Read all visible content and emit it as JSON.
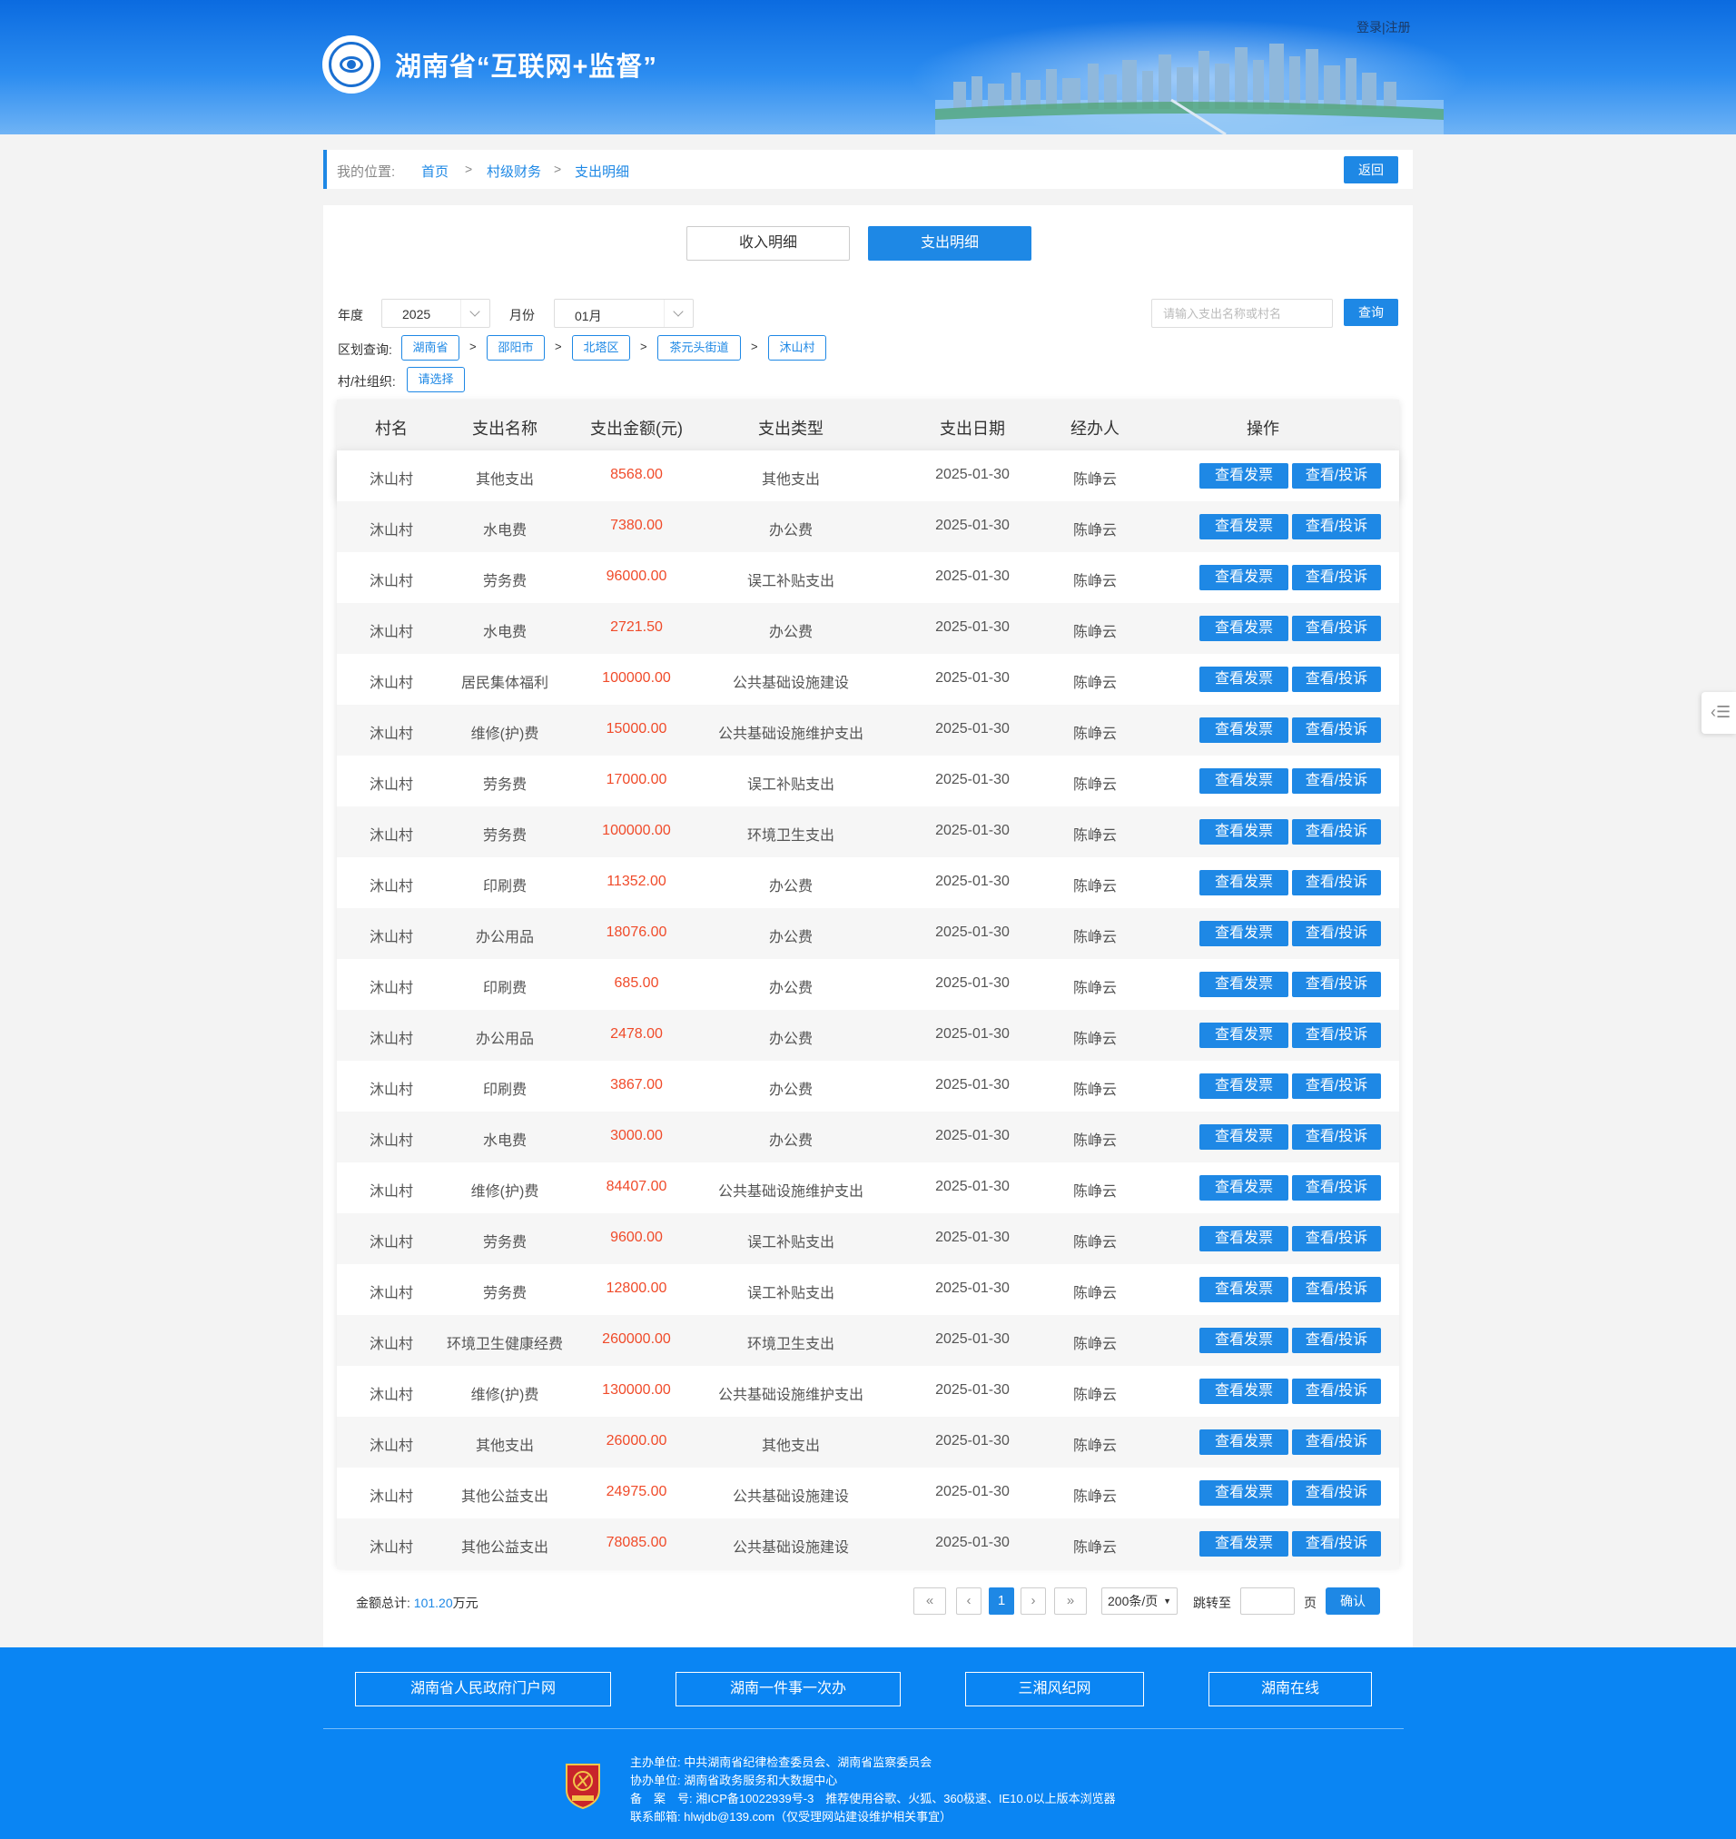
{
  "header": {
    "site_title": "湖南省“互联网+监督”",
    "login": "登录",
    "divider": "|",
    "register": "注册"
  },
  "breadcrumb": {
    "label": "我的位置:",
    "items": [
      "首页",
      "村级财务",
      "支出明细"
    ],
    "sep": ">",
    "back": "返回"
  },
  "tabs": {
    "income": "收入明细",
    "expense": "支出明细"
  },
  "filters": {
    "year_label": "年度",
    "year_value": "2025",
    "month_label": "月份",
    "month_value": "01月",
    "search_placeholder": "请输入支出名称或村名",
    "query": "查询",
    "region_label": "区划查询:",
    "regions": [
      "湖南省",
      "邵阳市",
      "北塔区",
      "茶元头街道",
      "沐山村"
    ],
    "region_sep": ">",
    "org_label": "村/社组织:",
    "org_value": "请选择"
  },
  "table": {
    "headers": [
      "村名",
      "支出名称",
      "支出金额(元)",
      "支出类型",
      "支出日期",
      "经办人",
      "操作"
    ],
    "btn_invoice": "查看发票",
    "btn_complain": "查看/投诉",
    "rows": [
      [
        "沐山村",
        "其他支出",
        "8568.00",
        "其他支出",
        "2025-01-30",
        "陈峥云"
      ],
      [
        "沐山村",
        "水电费",
        "7380.00",
        "办公费",
        "2025-01-30",
        "陈峥云"
      ],
      [
        "沐山村",
        "劳务费",
        "96000.00",
        "误工补贴支出",
        "2025-01-30",
        "陈峥云"
      ],
      [
        "沐山村",
        "水电费",
        "2721.50",
        "办公费",
        "2025-01-30",
        "陈峥云"
      ],
      [
        "沐山村",
        "居民集体福利",
        "100000.00",
        "公共基础设施建设",
        "2025-01-30",
        "陈峥云"
      ],
      [
        "沐山村",
        "维修(护)费",
        "15000.00",
        "公共基础设施维护支出",
        "2025-01-30",
        "陈峥云"
      ],
      [
        "沐山村",
        "劳务费",
        "17000.00",
        "误工补贴支出",
        "2025-01-30",
        "陈峥云"
      ],
      [
        "沐山村",
        "劳务费",
        "100000.00",
        "环境卫生支出",
        "2025-01-30",
        "陈峥云"
      ],
      [
        "沐山村",
        "印刷费",
        "11352.00",
        "办公费",
        "2025-01-30",
        "陈峥云"
      ],
      [
        "沐山村",
        "办公用品",
        "18076.00",
        "办公费",
        "2025-01-30",
        "陈峥云"
      ],
      [
        "沐山村",
        "印刷费",
        "685.00",
        "办公费",
        "2025-01-30",
        "陈峥云"
      ],
      [
        "沐山村",
        "办公用品",
        "2478.00",
        "办公费",
        "2025-01-30",
        "陈峥云"
      ],
      [
        "沐山村",
        "印刷费",
        "3867.00",
        "办公费",
        "2025-01-30",
        "陈峥云"
      ],
      [
        "沐山村",
        "水电费",
        "3000.00",
        "办公费",
        "2025-01-30",
        "陈峥云"
      ],
      [
        "沐山村",
        "维修(护)费",
        "84407.00",
        "公共基础设施维护支出",
        "2025-01-30",
        "陈峥云"
      ],
      [
        "沐山村",
        "劳务费",
        "9600.00",
        "误工补贴支出",
        "2025-01-30",
        "陈峥云"
      ],
      [
        "沐山村",
        "劳务费",
        "12800.00",
        "误工补贴支出",
        "2025-01-30",
        "陈峥云"
      ],
      [
        "沐山村",
        "环境卫生健康经费",
        "260000.00",
        "环境卫生支出",
        "2025-01-30",
        "陈峥云"
      ],
      [
        "沐山村",
        "维修(护)费",
        "130000.00",
        "公共基础设施维护支出",
        "2025-01-30",
        "陈峥云"
      ],
      [
        "沐山村",
        "其他支出",
        "26000.00",
        "其他支出",
        "2025-01-30",
        "陈峥云"
      ],
      [
        "沐山村",
        "其他公益支出",
        "24975.00",
        "公共基础设施建设",
        "2025-01-30",
        "陈峥云"
      ],
      [
        "沐山村",
        "其他公益支出",
        "78085.00",
        "公共基础设施建设",
        "2025-01-30",
        "陈峥云"
      ]
    ]
  },
  "summary": {
    "label": "金额总计:",
    "value": "101.20",
    "unit": "万元"
  },
  "pagination": {
    "first": "«",
    "prev": "‹",
    "current": "1",
    "next": "›",
    "last": "»",
    "page_size": "200条/页",
    "jump_label": "跳转至",
    "page_unit": "页",
    "confirm": "确认"
  },
  "footer": {
    "links": [
      "湖南省人民政府门户网",
      "湖南一件事一次办",
      "三湘风纪网",
      "湖南在线"
    ],
    "lines": [
      "主办单位: 中共湖南省纪律检查委员会、湖南省监察委员会",
      "协办单位: 湖南省政务服务和大数据中心",
      "备　案　号: 湘ICP备10022939号-3　推荐使用谷歌、火狐、360极速、IE10.0以上版本浏览器",
      "联系邮箱: hlwjdb@139.com（仅受理网站建设维护相关事宜）"
    ]
  },
  "colors": {
    "primary": "#1e88e5",
    "amount": "#f04b2a",
    "footer": "#0a85f3"
  }
}
